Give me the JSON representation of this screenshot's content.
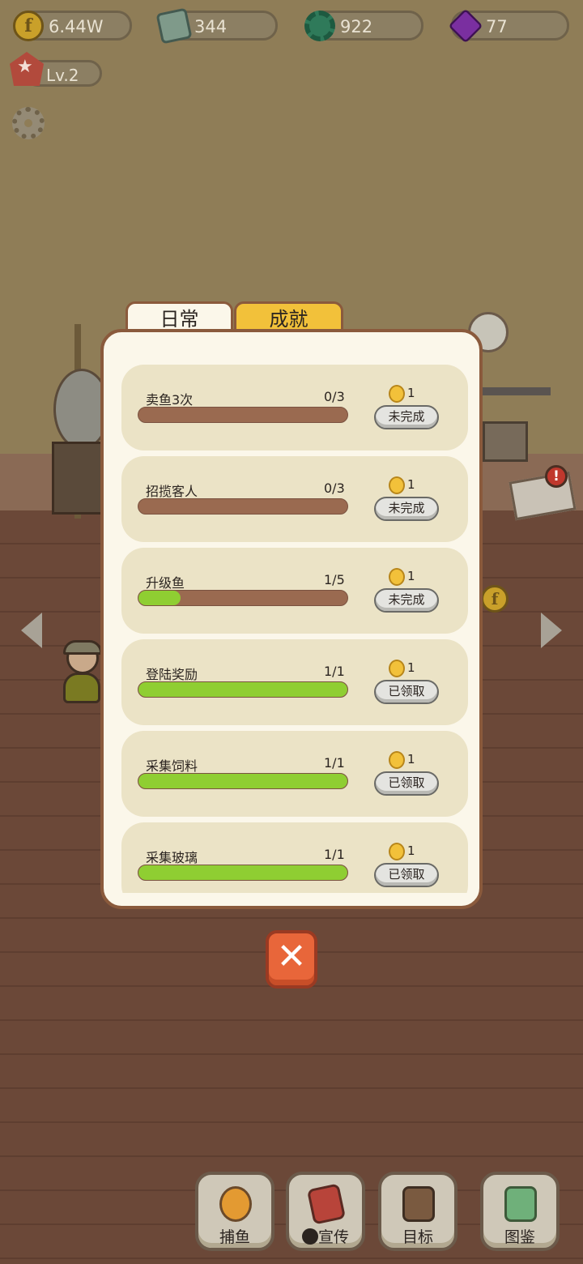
{
  "resources": [
    {
      "icon": "coin-icon",
      "value": "6.44W"
    },
    {
      "icon": "paper-stack-icon",
      "value": "344"
    },
    {
      "icon": "green-gear-icon",
      "value": "922"
    },
    {
      "icon": "gem-icon",
      "value": "77"
    }
  ],
  "level": {
    "label": "Lv.2"
  },
  "tabs": {
    "daily": "日常",
    "achievements": "成就",
    "active": "daily"
  },
  "tasks": [
    {
      "name": "卖鱼3次",
      "progress": "0/3",
      "fraction": 0.0,
      "reward": "1",
      "status": "未完成"
    },
    {
      "name": "招揽客人",
      "progress": "0/3",
      "fraction": 0.0,
      "reward": "1",
      "status": "未完成"
    },
    {
      "name": "升级鱼",
      "progress": "1/5",
      "fraction": 0.2,
      "reward": "1",
      "status": "未完成"
    },
    {
      "name": "登陆奖励",
      "progress": "1/1",
      "fraction": 1.0,
      "reward": "1",
      "status": "已领取"
    },
    {
      "name": "采集饲料",
      "progress": "1/1",
      "fraction": 1.0,
      "reward": "1",
      "status": "已领取"
    },
    {
      "name": "采集玻璃",
      "progress": "1/1",
      "fraction": 1.0,
      "reward": "1",
      "status": "已领取"
    }
  ],
  "close_label": "✕",
  "nav": [
    {
      "label": "捕鱼",
      "icon": "submarine-icon"
    },
    {
      "label": "宣传",
      "icon": "promo-book-icon"
    },
    {
      "label": "目标",
      "icon": "target-checklist-icon"
    },
    {
      "label": "图鉴",
      "icon": "fish-album-icon"
    }
  ],
  "colors": {
    "accent": "#f2c13a",
    "progress_fill": "#8fce32",
    "progress_empty": "#9a6a50",
    "close": "#e8663a"
  }
}
